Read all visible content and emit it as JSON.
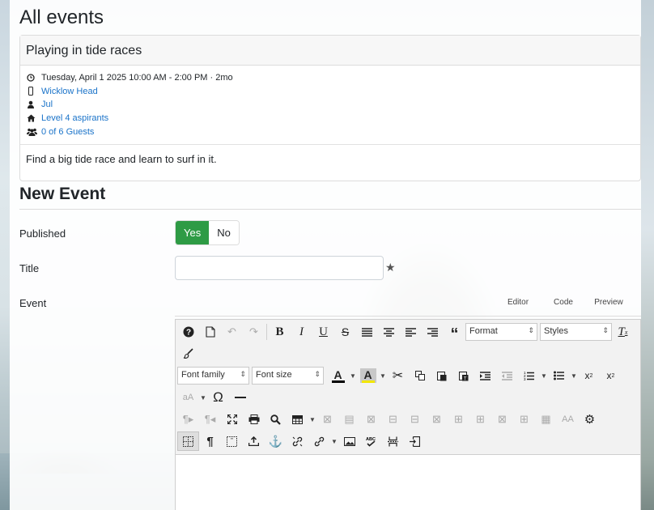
{
  "page": {
    "title": "All events"
  },
  "event_card": {
    "title": "Playing in tide races",
    "datetime": "Tuesday, April 1 2025 10:00 AM - 2:00 PM · 2mo",
    "location": "Wicklow Head",
    "organizer": "Jul",
    "group": "Level 4 aspirants",
    "guests": "0 of 6 Guests",
    "description": "Find a big tide race and learn to surf in it.",
    "icons": [
      "clock-icon",
      "phone-icon",
      "user-icon",
      "home-icon",
      "users-icon"
    ]
  },
  "new_event": {
    "heading": "New Event",
    "published_label": "Published",
    "published_yes": "Yes",
    "published_no": "No",
    "published_value": "Yes",
    "title_label": "Title",
    "title_value": "",
    "event_label": "Event",
    "editor_tabs": [
      "Editor",
      "Code",
      "Preview"
    ]
  },
  "editor": {
    "format_select": "Format",
    "styles_select": "Styles",
    "font_family_select": "Font family",
    "font_size_select": "Font size",
    "body_text": ""
  },
  "colors": {
    "accent_green": "#2e9b45",
    "link_blue": "#1a73c9",
    "text_color_bar": "#000000",
    "highlight_color_bar": "#f2e600"
  }
}
